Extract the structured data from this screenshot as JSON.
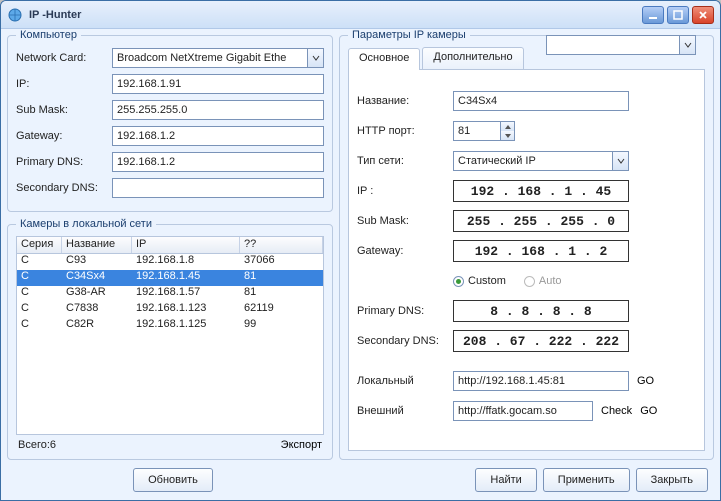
{
  "window": {
    "title": "IP  -Hunter"
  },
  "groups": {
    "computer": "Компьютер",
    "cameras_lan": "Камеры в локальной сети",
    "cam_params": "Параметры IP камеры"
  },
  "labels": {
    "network_card": "Network Card:",
    "ip": "IP:",
    "submask": "Sub Mask:",
    "gateway": "Gateway:",
    "primary_dns": "Primary DNS:",
    "secondary_dns": "Secondary DNS:",
    "series": "Серия",
    "name_col": "Название",
    "ip_col": "IP",
    "unknown_col": "??",
    "total": "Всего:6",
    "export": "Экспорт",
    "tab_main": "Основное",
    "tab_extra": "Дополнительно",
    "name": "Название:",
    "http_port": "HTTP порт:",
    "net_type": "Тип сети:",
    "ip_r": "IP :",
    "submask_r": "Sub Mask:",
    "gateway_r": "Gateway:",
    "custom": "Custom",
    "auto": "Auto",
    "pdns_r": "Primary DNS:",
    "sdns_r": "Secondary DNS:",
    "local": "Локальный",
    "external": "Внешний",
    "go": "GO",
    "check": "Check",
    "btn_refresh": "Обновить",
    "btn_find": "Найти",
    "btn_apply": "Применить",
    "btn_close": "Закрыть"
  },
  "computer": {
    "network_card": "Broadcom NetXtreme Gigabit Ethe",
    "ip": "192.168.1.91",
    "submask": "255.255.255.0",
    "gateway": "192.168.1.2",
    "primary_dns": "192.168.1.2",
    "secondary_dns": ""
  },
  "cameras": [
    {
      "series": "C",
      "name": "C93",
      "ip": "192.168.1.8",
      "port": "37066"
    },
    {
      "series": "C",
      "name": "C34Sx4",
      "ip": "192.168.1.45",
      "port": "81",
      "selected": true
    },
    {
      "series": "C",
      "name": "G38-AR",
      "ip": "192.168.1.57",
      "port": "81"
    },
    {
      "series": "C",
      "name": "C7838",
      "ip": "192.168.1.123",
      "port": "62119"
    },
    {
      "series": "C",
      "name": "C82R",
      "ip": "192.168.1.125",
      "port": "99"
    }
  ],
  "camera_select": "",
  "cam": {
    "name": "C34Sx4",
    "http_port": "81",
    "net_type": "Статический IP",
    "ip": "192 . 168 .  1  .  45",
    "submask": "255 . 255 . 255 .  0",
    "gateway": "192 . 168 .  1  .  2",
    "dns_mode": "custom",
    "primary_dns": "8  .  8  .  8  .  8",
    "secondary_dns": "208 .  67 . 222 . 222",
    "local_url": "http://192.168.1.45:81",
    "external_url": "http://ffatk.gocam.so"
  }
}
